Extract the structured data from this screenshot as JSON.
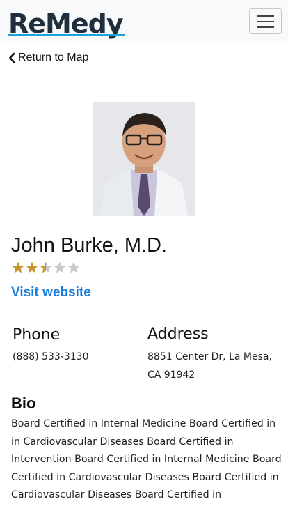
{
  "navbar": {
    "logo_text": "ReMedy",
    "accent_color": "#1aa3d8",
    "menu_icon": "hamburger-icon"
  },
  "back_link": {
    "icon": "chevron-left-icon",
    "label": "Return to Map"
  },
  "doctor": {
    "name": "John Burke, M.D.",
    "rating": 2.5,
    "rating_max": 5,
    "website_label": "Visit website",
    "phone": {
      "heading": "Phone",
      "value": "(888) 533-3130"
    },
    "address": {
      "heading": "Address",
      "line1": "8851 Center Dr, La Mesa,",
      "line2": "CA 91942"
    },
    "bio": {
      "heading": "Bio",
      "text": "Board Certified in Internal Medicine Board Certified in in Cardiovascular Diseases Board Certified in Intervention Board Certified in Internal Medicine Board Certified in Cardiovascular Diseases Board Certified in Cardiovascular Diseases Board Certified in"
    }
  },
  "colors": {
    "star_filled": "#c8962e",
    "star_empty": "#c9c9c9",
    "link": "#1a7fdc"
  }
}
